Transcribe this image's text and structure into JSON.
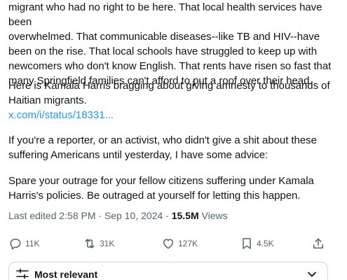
{
  "post": {
    "paragraph_1": "migrant who had no right to be here. That local health services have been\noverwhelmed. That communicable diseases--like TB and HIV--have\nbeen on the rise. That local schools have struggled to keep up with\nnewcomers who don't know English. That rents have risen so fast that\nmany Springfield families can't afford to put a roof over their head.",
    "paragraph_2": "Here is Kamala Harris bragging about giving amnesty to thousands of\nHaitian migrants.",
    "link_text": "x.com/i/status/18331...",
    "paragraph_3": "If you're a reporter, or an activist, who didn't give a shit about these\nsuffering Americans  until yesterday, I have some advice:",
    "paragraph_4": "Spare your outrage for your fellow citizens suffering under Kamala\nHarris's policies. Be outraged at yourself for letting this happen."
  },
  "meta": {
    "edited": "Last edited 2:58 PM · Sep 10, 2024 · ",
    "views_count": "15.5M",
    "views_label": " Views"
  },
  "actions": {
    "replies": "11K",
    "reposts": "31K",
    "likes": "127K",
    "bookmarks": "4.5K"
  },
  "sort": {
    "label": "Most relevant"
  },
  "icons": {
    "reply": "reply-icon",
    "repost": "repost-icon",
    "like": "heart-icon",
    "bookmark": "bookmark-icon",
    "share": "share-icon",
    "sort": "sliders-icon",
    "chevron": "chevron-down-icon"
  },
  "colors": {
    "link": "#1d9bf0",
    "secondary_text": "#536471",
    "primary_text": "#0f1419"
  }
}
